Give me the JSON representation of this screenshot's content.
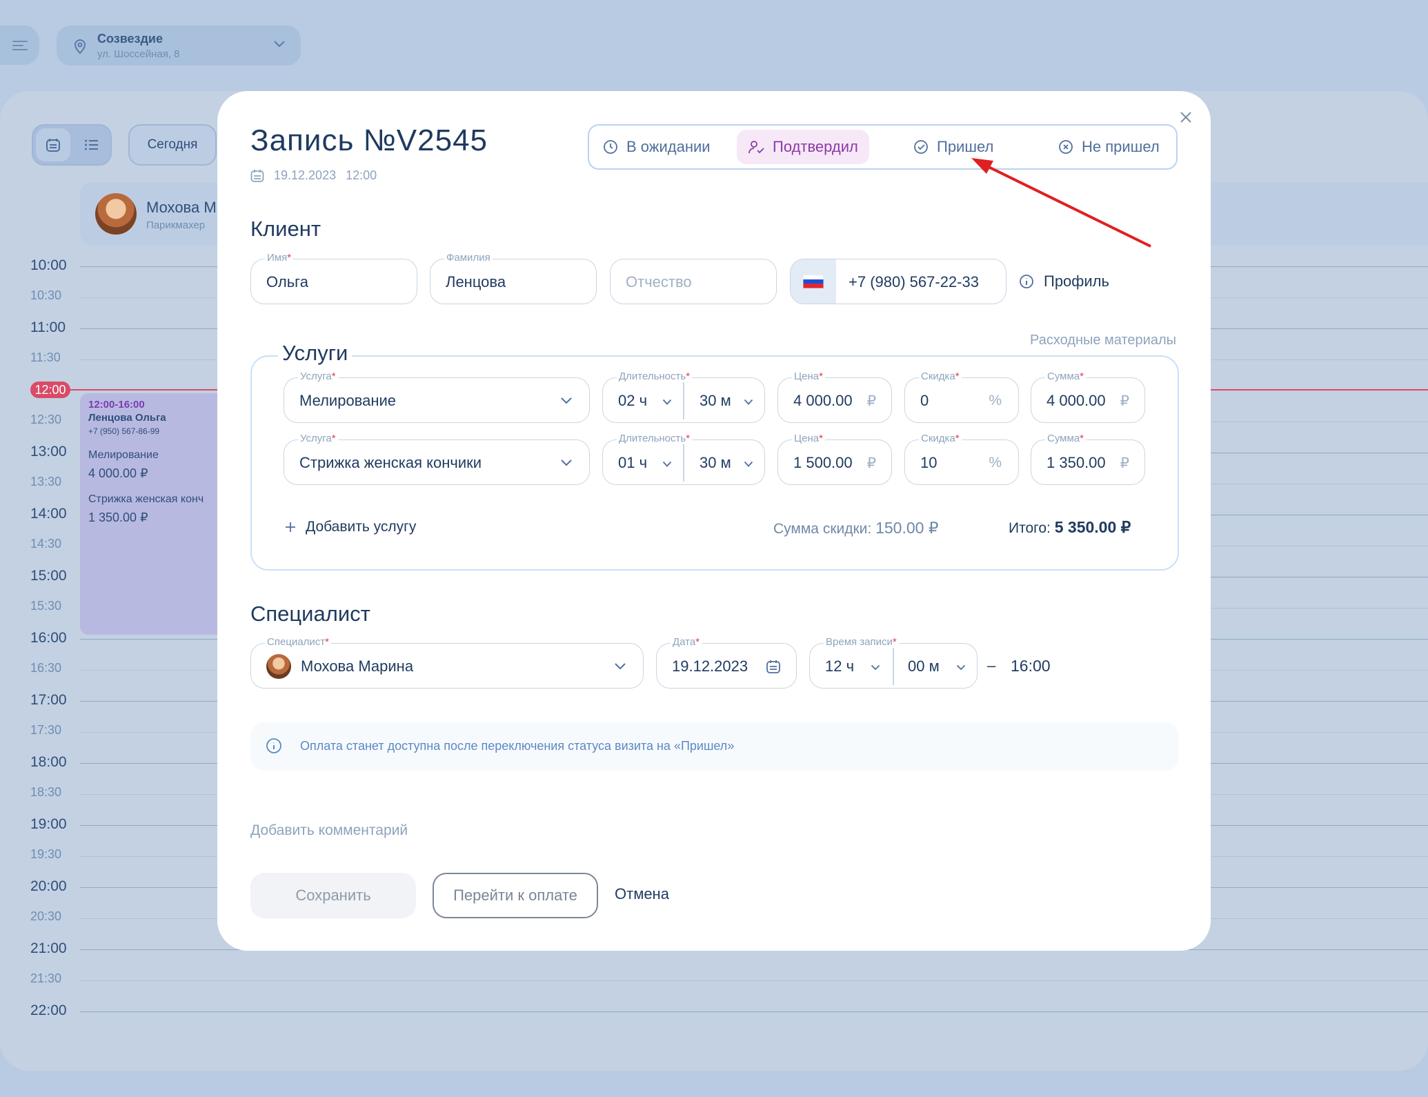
{
  "location": {
    "name": "Созвездие",
    "address": "ул. Шоссейная, 8"
  },
  "toolbar": {
    "today": "Сегодня"
  },
  "staff": {
    "name": "Мохова М",
    "role": "Парикмахер"
  },
  "timeline": {
    "times": [
      "10:00",
      "10:30",
      "11:00",
      "11:30",
      "12:30",
      "13:00",
      "13:30",
      "14:00",
      "14:30",
      "15:00",
      "15:30",
      "16:00",
      "16:30",
      "17:00",
      "17:30",
      "18:00",
      "18:30",
      "19:00",
      "19:30",
      "20:00",
      "20:30",
      "21:00",
      "21:30",
      "22:00"
    ],
    "now": "12:00"
  },
  "appointment_card": {
    "time": "12:00-16:00",
    "client": "Ленцова Ольга",
    "phone": "+7 (950) 567-86-99",
    "service1": "Мелирование",
    "price1": "4 000.00 ₽",
    "service2": "Стрижка женская конч",
    "price2": "1 350.00 ₽"
  },
  "modal": {
    "title": "Запись №V2545",
    "date": "19.12.2023",
    "time": "12:00",
    "statuses": [
      "В ожидании",
      "Подтвердил",
      "Пришел",
      "Не пришел"
    ],
    "active_status": "Подтвердил"
  },
  "client": {
    "heading": "Клиент",
    "first_name_label": "Имя",
    "first_name": "Ольга",
    "last_name_label": "Фамилия",
    "last_name": "Ленцова",
    "patronymic_placeholder": "Отчество",
    "phone": "+7 (980) 567-22-33",
    "profile": "Профиль"
  },
  "services": {
    "heading": "Услуги",
    "consumables": "Расходные материалы",
    "labels": {
      "service": "Услуга",
      "duration": "Длительность",
      "price": "Цена",
      "discount": "Скидка",
      "sum": "Сумма"
    },
    "rows": [
      {
        "service": "Мелирование",
        "hours": "02 ч",
        "minutes": "30 м",
        "price": "4 000.00",
        "discount": "0",
        "sum": "4 000.00"
      },
      {
        "service": "Стрижка женская кончики",
        "hours": "01 ч",
        "minutes": "30 м",
        "price": "1 500.00",
        "discount": "10",
        "sum": "1 350.00"
      }
    ],
    "currency": "₽",
    "percent": "%",
    "add": "Добавить услугу",
    "discount_label": "Сумма скидки:",
    "discount_total": "150.00 ₽",
    "total_label": "Итого:",
    "total": "5 350.00 ₽"
  },
  "specialist": {
    "heading": "Специалист",
    "label": "Специалист",
    "name": "Мохова Марина",
    "date_label": "Дата",
    "date": "19.12.2023",
    "time_label": "Время записи",
    "hours": "12 ч",
    "minutes": "00 м",
    "dash": "–",
    "end": "16:00"
  },
  "info": "Оплата станет доступна после переключения статуса визита на «Пришел»",
  "comment": "Добавить комментарий",
  "actions": {
    "save": "Сохранить",
    "pay": "Перейти к оплате",
    "cancel": "Отмена"
  },
  "colors": {
    "accent": "#8b3aa8",
    "now_line": "#d94b67",
    "annotation_arrow": "#e02020"
  }
}
